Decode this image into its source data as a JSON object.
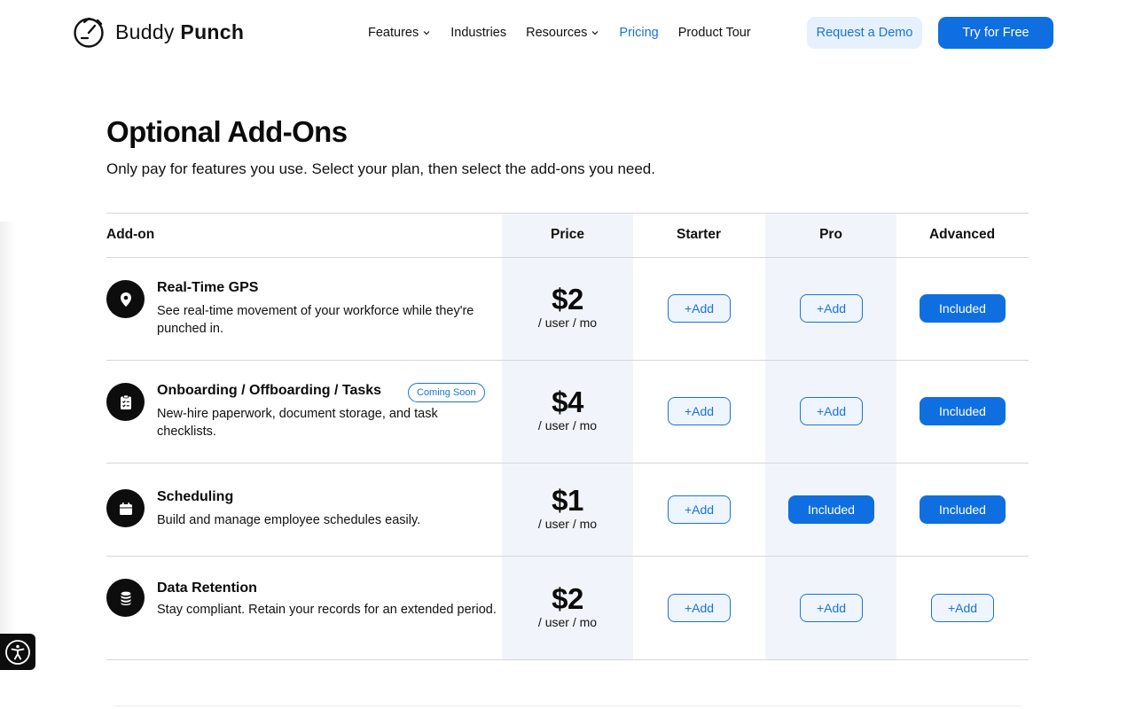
{
  "header": {
    "logo": {
      "part1": "Buddy",
      "part2": "Punch"
    },
    "nav": [
      {
        "label": "Features",
        "dropdown": true,
        "active": false
      },
      {
        "label": "Industries",
        "dropdown": false,
        "active": false
      },
      {
        "label": "Resources",
        "dropdown": true,
        "active": false
      },
      {
        "label": "Pricing",
        "dropdown": false,
        "active": true
      },
      {
        "label": "Product Tour",
        "dropdown": false,
        "active": false
      }
    ],
    "request_demo_label": "Request a Demo",
    "try_free_label": "Try for Free"
  },
  "section": {
    "title": "Optional Add-Ons",
    "subtitle": "Only pay for features you use. Select your plan, then select the add-ons you need."
  },
  "table": {
    "headers": [
      "Add-on",
      "Price",
      "Starter",
      "Pro",
      "Advanced"
    ],
    "rows": [
      {
        "icon": "map-pin-icon",
        "title": "Real-Time GPS",
        "badge": "",
        "description": "See real-time movement of your workforce while they're punched in.",
        "price": "$2",
        "price_unit": "/ user / mo",
        "starter": "+Add",
        "pro": "+Add",
        "advanced": "Included"
      },
      {
        "icon": "clipboard-checklist-icon",
        "title": "Onboarding / Offboarding / Tasks",
        "badge": "Coming Soon",
        "description": "New-hire paperwork, document storage, and task checklists.",
        "price": "$4",
        "price_unit": "/ user / mo",
        "starter": "+Add",
        "pro": "+Add",
        "advanced": "Included"
      },
      {
        "icon": "calendar-icon",
        "title": "Scheduling",
        "badge": "",
        "description": "Build and manage employee schedules easily.",
        "price": "$1",
        "price_unit": "/ user / mo",
        "starter": "+Add",
        "pro": "Included",
        "advanced": "Included"
      },
      {
        "icon": "database-icon",
        "title": "Data Retention",
        "badge": "",
        "description": "Stay compliant. Retain your records for an extended period.",
        "price": "$2",
        "price_unit": "/ user / mo",
        "starter": "+Add",
        "pro": "+Add",
        "advanced": "+Add"
      }
    ]
  },
  "colors": {
    "accent": "#0f6fe0",
    "accent_text": "#1a73d9",
    "demo_button_bg": "#e6f1fd",
    "column_shade": "#f1f5fb"
  },
  "accessibility": {
    "icon": "accessibility-icon"
  }
}
